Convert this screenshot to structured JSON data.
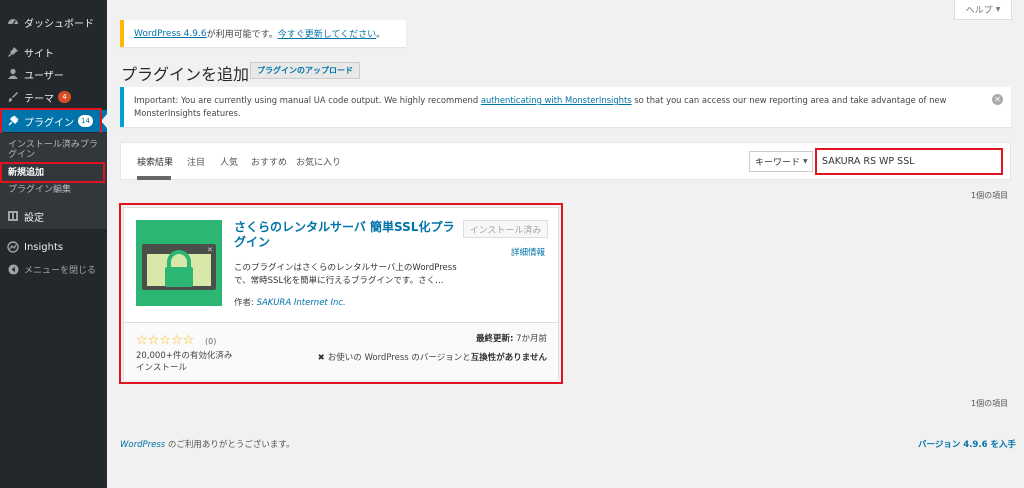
{
  "sidebar": {
    "dashboard": "ダッシュボード",
    "posts": "サイト",
    "users": "ユーザー",
    "themes": "テーマ",
    "themes_badge": "4",
    "plugins": "プラグイン",
    "plugins_badge": "14",
    "sub_installed": "インストール済みプラグイン",
    "sub_add_new": "新規追加",
    "sub_editor": "プラグイン編集",
    "settings": "設定",
    "insights": "Insights",
    "collapse": "メニューを閉じる"
  },
  "help_tab": "ヘルプ",
  "update_notice": {
    "link1": "WordPress 4.9.6",
    "text": " が利用可能です。",
    "link2": "今すぐ更新してください",
    "end": "。"
  },
  "page": {
    "title": "プラグインを追加",
    "upload_button": "プラグインのアップロード"
  },
  "info_notice": {
    "before": "Important: You are currently using manual UA code output. We highly recommend ",
    "link": "authenticating with MonsterInsights",
    "after": " so that you can access our new reporting area and take advantage of new MonsterInsights features."
  },
  "filter": {
    "tabs": [
      "検索結果",
      "注目",
      "人気",
      "おすすめ",
      "お気に入り"
    ],
    "search_type": "キーワード",
    "search_value": "SAKURA RS WP SSL"
  },
  "item_count": "1個の項目",
  "plugin": {
    "name": "さくらのレンタルサーバ 簡単SSL化プラグイン",
    "install_label": "インストール済み",
    "details": "詳細情報",
    "description": "このプラグインはさくらのレンタルサーバ上のWordPressで、常時SSL化を簡単に行えるプラグインです。さく…",
    "author_label": "作者: ",
    "author": "SAKURA Internet Inc.",
    "stars": "☆☆☆☆☆",
    "rating_count": "(0)",
    "installs": "20,000+件の有効化済みインストール",
    "updated_label": "最終更新:",
    "updated_value": " 7か月前",
    "compat_text": "お使いの WordPress のバージョンと",
    "compat_bold": "互換性がありません"
  },
  "footer": {
    "wp": "WordPress",
    "thanks": " のご利用ありがとうございます。",
    "version": "バージョン 4.9.6 を入手"
  },
  "colors": {
    "sidebar": "#23282d",
    "submenu": "#32373c",
    "accent": "#0073aa",
    "highlight": "#e0141e",
    "icon_green": "#2bb673",
    "notice_yellow": "#ffb900",
    "notice_blue": "#00a0d2"
  }
}
